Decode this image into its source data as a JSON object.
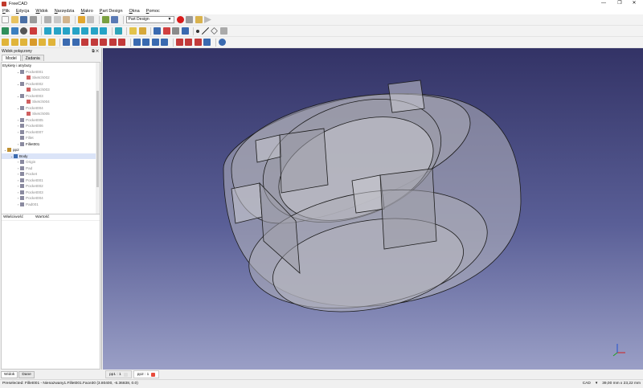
{
  "window": {
    "title": "FreeCAD",
    "minimize": "—",
    "maximize": "❐",
    "close": "✕"
  },
  "menu": [
    "Plik",
    "Edycja",
    "Widok",
    "Narzędzia",
    "Makro",
    "Part Design",
    "Okna",
    "Pomoc"
  ],
  "workbench_selector": {
    "value": "Part Design"
  },
  "combo_view": {
    "title": "Widok połączony",
    "tabs": [
      "Model",
      "Zadania"
    ],
    "tree_header": "Etykiety i atrybuty",
    "tree": [
      {
        "label": "Pocket001",
        "level": 2,
        "arrow": "v",
        "muted": true
      },
      {
        "label": "Sketch002",
        "level": 3,
        "arrow": "",
        "muted": true
      },
      {
        "label": "Pocket002",
        "level": 2,
        "arrow": "v",
        "muted": true
      },
      {
        "label": "Sketch003",
        "level": 3,
        "arrow": "",
        "muted": true
      },
      {
        "label": "Pocket003",
        "level": 2,
        "arrow": "v",
        "muted": true
      },
      {
        "label": "Sketch004",
        "level": 3,
        "arrow": "",
        "muted": true
      },
      {
        "label": "Pocket004",
        "level": 2,
        "arrow": "v",
        "muted": true
      },
      {
        "label": "Sketch005",
        "level": 3,
        "arrow": "",
        "muted": true
      },
      {
        "label": "Pocket005",
        "level": 2,
        "arrow": ">",
        "muted": true
      },
      {
        "label": "Pocket006",
        "level": 2,
        "arrow": ">",
        "muted": true
      },
      {
        "label": "Pocket007",
        "level": 2,
        "arrow": ">",
        "muted": true
      },
      {
        "label": "Fillet",
        "level": 2,
        "arrow": "",
        "muted": true
      },
      {
        "label": "Fillet001",
        "level": 2,
        "arrow": ">",
        "muted": false
      },
      {
        "label": "pp2",
        "level": 0,
        "arrow": "v",
        "muted": false
      },
      {
        "label": "Body",
        "level": 1,
        "arrow": "v",
        "muted": false,
        "selected": true
      },
      {
        "label": "Origin",
        "level": 2,
        "arrow": ">",
        "muted": true
      },
      {
        "label": "Pad",
        "level": 2,
        "arrow": ">",
        "muted": true
      },
      {
        "label": "Pocket",
        "level": 2,
        "arrow": ">",
        "muted": true
      },
      {
        "label": "Pocket001",
        "level": 2,
        "arrow": ">",
        "muted": true
      },
      {
        "label": "Pocket002",
        "level": 2,
        "arrow": ">",
        "muted": true
      },
      {
        "label": "Pocket003",
        "level": 2,
        "arrow": ">",
        "muted": true
      },
      {
        "label": "Pocket004",
        "level": 2,
        "arrow": ">",
        "muted": true
      },
      {
        "label": "Pad001",
        "level": 2,
        "arrow": ">",
        "muted": true
      }
    ],
    "properties_columns": [
      "Właściwość",
      "Wartość"
    ],
    "bottom_tabs": [
      "Widok",
      "Dane"
    ]
  },
  "documents": [
    {
      "label": "pp1 : 1",
      "active": false
    },
    {
      "label": "pp2 : 1",
      "active": true
    }
  ],
  "status": {
    "preselected": "Preselected: Fillet001 - Nienazwany1.Fillet001.Face30 (3.80400, -6.36838, 0.0)",
    "nav_style": "CAD",
    "dimensions": "39,00 mm x 23,22 mm"
  },
  "colors": {
    "viewport_top": "#333366",
    "viewport_bottom": "#9a9fc6",
    "record_button": "#d81b1b"
  },
  "icons": {
    "toolbar1": [
      "new-icon",
      "open-icon",
      "save-icon",
      "print-icon",
      "cut-icon",
      "copy-icon",
      "paste-icon",
      "undo-icon",
      "redo-icon",
      "refresh-icon",
      "whats-this-icon"
    ],
    "macro": [
      "record-macro-icon",
      "stop-macro-icon",
      "edit-macro-icon",
      "run-macro-icon"
    ]
  }
}
